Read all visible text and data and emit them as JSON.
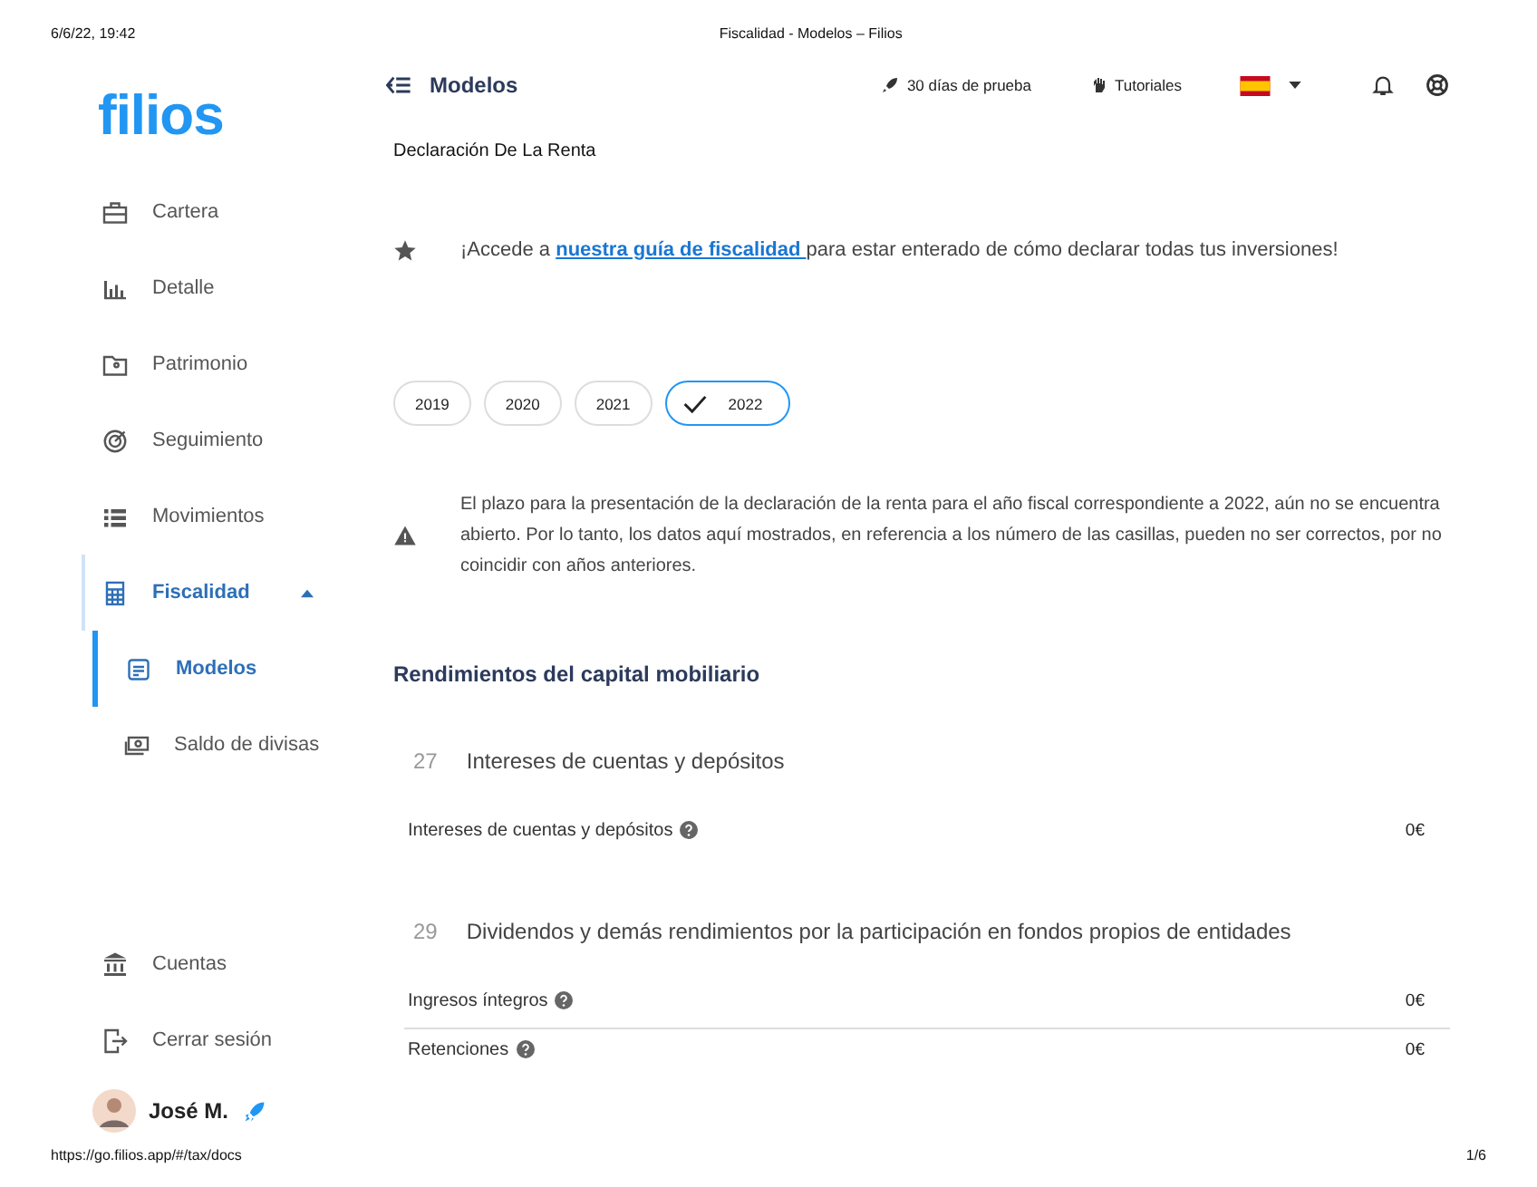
{
  "print_header": {
    "date": "6/6/22, 19:42",
    "title": "Fiscalidad - Modelos – Filios"
  },
  "sidebar": {
    "logo": "filios",
    "items": [
      {
        "label": "Cartera",
        "kind": "briefcase",
        "selected": false
      },
      {
        "label": "Detalle",
        "kind": "chart",
        "selected": false
      },
      {
        "label": "Patrimonio",
        "kind": "folder",
        "selected": false
      },
      {
        "label": "Seguimiento",
        "kind": "target",
        "selected": false
      },
      {
        "label": "Movimientos",
        "kind": "list",
        "selected": false
      },
      {
        "label": "Fiscalidad",
        "kind": "calculator",
        "selected": true,
        "expanded": true,
        "children": [
          {
            "label": "Modelos",
            "kind": "doc",
            "selected": true
          },
          {
            "label": "Saldo de divisas",
            "kind": "money",
            "selected": false
          }
        ]
      }
    ],
    "bottom_items": [
      {
        "label": "Cuentas",
        "kind": "bank"
      },
      {
        "label": "Cerrar sesión",
        "kind": "logout"
      }
    ],
    "user": {
      "name": "José M."
    }
  },
  "topbar": {
    "title": "Modelos",
    "trial": "30 días de prueba",
    "tutorials": "Tutoriales"
  },
  "subtitle": "Declaración De La Renta",
  "tip": {
    "before": "¡Accede a ",
    "link": "nuestra guía de fiscalidad ",
    "after": "para estar enterado de cómo declarar todas tus inversiones!"
  },
  "years": [
    {
      "label": "2019",
      "selected": false
    },
    {
      "label": "2020",
      "selected": false
    },
    {
      "label": "2021",
      "selected": false
    },
    {
      "label": "2022",
      "selected": true
    }
  ],
  "warning": "El plazo para la presentación de la declaración de la renta para el año fiscal correspondiente a 2022, aún no se encuentra abierto. Por lo tanto, los datos aquí mostrados, en referencia a los número de las casillas, pueden no ser correctos, por no coincidir con años anteriores.",
  "section_title": "Rendimientos del capital mobiliario",
  "groups": [
    {
      "number": "27",
      "title": "Intereses de cuentas y depósitos",
      "rows": [
        {
          "label": "Intereses de cuentas y depósitos",
          "value": "0€"
        }
      ]
    },
    {
      "number": "29",
      "title": "Dividendos y demás rendimientos por la participación en fondos propios de entidades",
      "rows": [
        {
          "label": "Ingresos íntegros",
          "value": "0€"
        },
        {
          "label": "Retenciones",
          "value": "0€"
        }
      ]
    }
  ],
  "print_footer": {
    "url": "https://go.filios.app/#/tax/docs",
    "page": "1/6"
  }
}
